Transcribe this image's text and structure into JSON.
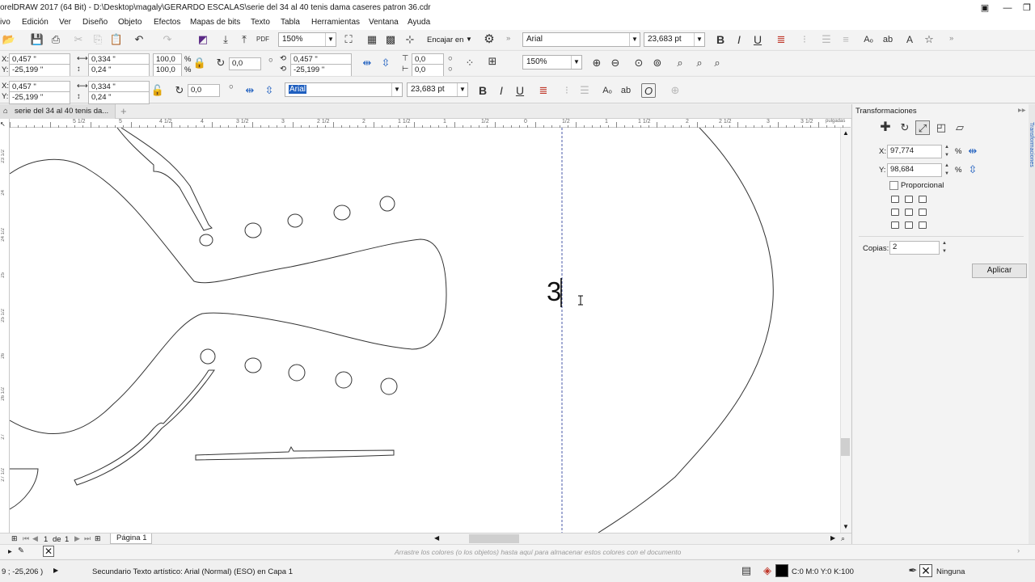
{
  "window": {
    "title": "orelDRAW 2017 (64 Bit) - D:\\Desktop\\magaly\\GERARDO ESCALAS\\serie del 34 al 40 tenis dama caseres patron  36.cdr"
  },
  "menu": [
    "ivo",
    "Edición",
    "Ver",
    "Diseño",
    "Objeto",
    "Efectos",
    "Mapas de bits",
    "Texto",
    "Tabla",
    "Herramientas",
    "Ventana",
    "Ayuda"
  ],
  "standard_toolbar": {
    "zoom": "150%",
    "snap": "Encajar en",
    "font": "Arial",
    "font_size": "23,683 pt"
  },
  "property_bar_1": {
    "x": "0,457 \"",
    "y": "-25,199 \"",
    "width": "0,334 \"",
    "height": "0,24 \"",
    "scale_x": "100,0",
    "scale_y": "100,0",
    "percent": "%",
    "rotation": "0,0",
    "center_x": "0,457 \"",
    "center_y": "-25,199 \"",
    "skew_h": "0,0",
    "skew_v": "0,0",
    "zoom": "150%"
  },
  "property_bar_2": {
    "x": "0,457 \"",
    "y": "-25,199 \"",
    "width": "0,334 \"",
    "height": "0,24 \"",
    "rotation": "0,0",
    "font": "Arial",
    "font_size": "23,683 pt"
  },
  "document_tab": {
    "label": "serie del 34 al 40 tenis da..."
  },
  "ruler": {
    "labels": [
      "5",
      "5 1/2",
      "5",
      "4 1/2",
      "4",
      "3 1/2",
      "3",
      "2 1/2",
      "2",
      "1 1/2",
      "1",
      "1/2",
      "0",
      "1/2",
      "1",
      "1 1/2",
      "2",
      "2 1/2",
      "3",
      "3 1/2"
    ],
    "unit": "pulgadas",
    "vertical_labels": [
      "23 1/2",
      "24",
      "24 1/2",
      "25",
      "25 1/2",
      "26",
      "26 1/2",
      "27",
      "27 1/2"
    ]
  },
  "canvas": {
    "artistic_text": "3"
  },
  "page_nav": {
    "current": "1",
    "of_label": "de",
    "total": "1",
    "page_tab": "Página 1"
  },
  "palette": {
    "hint": "Arrastre los colores (o los objetos) hasta aquí para almacenar estos colores con el documento"
  },
  "status": {
    "cursor": "9 ; -25,206 )",
    "info": "Secundario Texto artístico: Arial (Normal) (ESO) en Capa 1",
    "fill_color": "C:0 M:0 Y:0 K:100",
    "outline": "Ninguna",
    "fill_hex": "#000000"
  },
  "docker": {
    "title": "Transformaciones",
    "x_label": "X:",
    "x_value": "97,774",
    "y_label": "Y:",
    "y_value": "98,684",
    "unit": "%",
    "proportional": "Proporcional",
    "copies_label": "Copias:",
    "copies_value": "2",
    "apply": "Aplicar",
    "side_tab": "Transformaciones"
  },
  "colors": {
    "accent": "#5b2a86",
    "guide": "#4a5aa8",
    "selection": "#1f5fbf"
  }
}
